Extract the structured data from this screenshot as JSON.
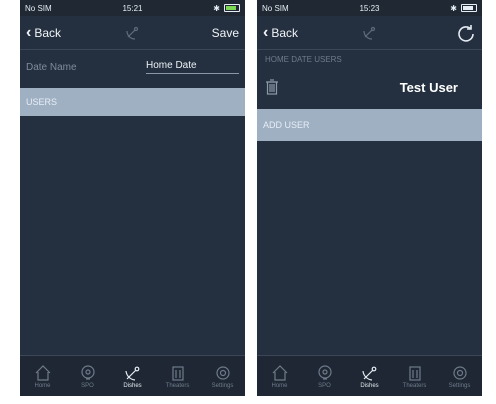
{
  "left": {
    "status": {
      "carrier": "No SIM",
      "time": "15:21"
    },
    "nav": {
      "back_label": "Back",
      "save_label": "Save"
    },
    "form": {
      "date_name_label": "Date Name",
      "date_name_value": "Home Date"
    },
    "users_header": "USERS"
  },
  "right": {
    "status": {
      "carrier": "No SIM",
      "time": "15:23"
    },
    "nav": {
      "back_label": "Back"
    },
    "section_label": "HOME DATE USERS",
    "user": {
      "name": "Test User"
    },
    "add_user_label": "ADD USER"
  },
  "tabs": [
    {
      "label": "Home",
      "icon": "house-icon"
    },
    {
      "label": "SPO",
      "icon": "face-icon"
    },
    {
      "label": "Dishes",
      "icon": "satellite-dish-icon"
    },
    {
      "label": "Theaters",
      "icon": "building-icon"
    },
    {
      "label": "Settings",
      "icon": "gear-icon"
    }
  ],
  "active_tab": "Dishes",
  "colors": {
    "screen_bg": "#243040",
    "section_bg": "#9fb0c3",
    "battery_green": "#7ed957"
  }
}
